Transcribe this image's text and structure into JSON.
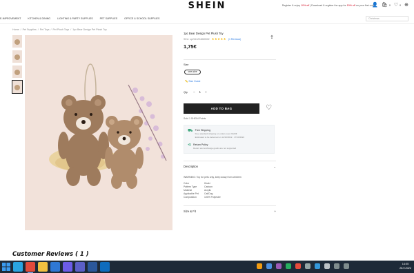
{
  "header": {
    "logo": "SHEIN",
    "promo": {
      "pre": "Register & enjoy ",
      "highlight1": "10% off",
      "mid": " | Download & register the app for ",
      "highlight2": "15% off",
      "post": " on your first order"
    },
    "icons": [
      "user-icon",
      "cart-icon",
      "heart-icon",
      "globe-icon"
    ],
    "cart_count": "0",
    "wish_count": "0"
  },
  "nav": {
    "items": [
      "E-IMPROVEMENT",
      "KITCHEN & DINING",
      "LIGHTING & PARTY SUPPLIES",
      "PET SUPPLIES",
      "OFFICE & SCHOOL SUPPLIES"
    ],
    "search_placeholder": "Christmas"
  },
  "breadcrumb": [
    "Home",
    "/",
    "Pet Supplies",
    "/",
    "Pet Toys",
    "/",
    "Pet Plush Toys",
    "/",
    "1pc Bear Design Pet Plush Toy"
  ],
  "product": {
    "title": "1pc Bear Design Pet Plush Toy",
    "sku": "SKU: sp2111204860502",
    "stars": "★★★★★",
    "reviews": "(1 Reviews)",
    "price": "1,75€",
    "size_label": "Size",
    "size_option": "one-size",
    "size_guide": "Size Guide",
    "qty_label": "Qty",
    "qty_minus": "−",
    "qty_value": "1",
    "qty_plus": "+",
    "add_to_bag": "ADD TO BAG",
    "sold_text": "Sold 1 SHEIN Points",
    "shipping_title": "Free Shipping",
    "shipping_sub": "Free standard shipping on orders over 29,00€",
    "shipping_sub2": "Estimated to be delivered on 12/10/2022 - 17/10/2022",
    "return_title": "Return Policy",
    "return_sub": "Return and exchange goods are not supported"
  },
  "description": {
    "title": "Description",
    "lead": "WARNING: Toy for pets only, keep away from children",
    "attributes": [
      {
        "k": "Color",
        "v": "Khaki"
      },
      {
        "k": "Pattern Type",
        "v": "Cartoon"
      },
      {
        "k": "Material",
        "v": "Acrylic"
      },
      {
        "k": "Applicable Pet",
        "v": "Cat/Dog"
      },
      {
        "k": "Composition",
        "v": "100% Polyester"
      }
    ],
    "size_fit": "Size & Fit",
    "toggle": "⌄",
    "toggle2": "+"
  },
  "reviews_heading": "Customer Reviews ( 1 )",
  "taskbar": {
    "apps": [
      {
        "name": "taskbar-edge-icon",
        "color": "#2aa4e0"
      },
      {
        "name": "taskbar-chrome-icon",
        "color": "#e24a3b"
      },
      {
        "name": "taskbar-explorer-icon",
        "color": "#f0c040"
      },
      {
        "name": "taskbar-mail-icon",
        "color": "#2f78d4"
      },
      {
        "name": "taskbar-store-icon",
        "color": "#6c5ce7"
      },
      {
        "name": "taskbar-teams-icon",
        "color": "#5b5fc7"
      },
      {
        "name": "taskbar-word-icon",
        "color": "#2b579a"
      },
      {
        "name": "taskbar-outlook-icon",
        "color": "#0f6cbd"
      }
    ],
    "time": "14:05",
    "date": "28.9.2022"
  }
}
